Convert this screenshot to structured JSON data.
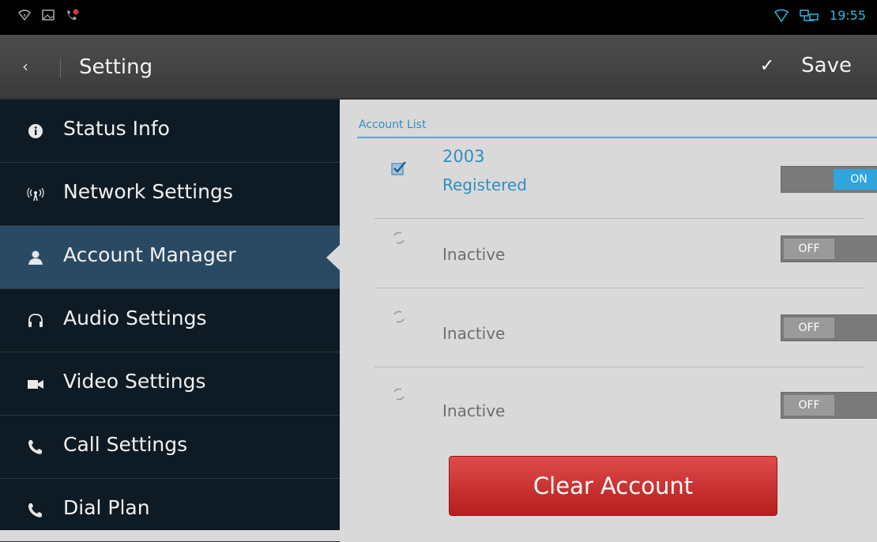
{
  "statusbar": {
    "time": "19:55"
  },
  "actionbar": {
    "back_glyph": "‹",
    "title": "Setting",
    "save_check": "✓",
    "save_label": "Save"
  },
  "sidebar": {
    "items": [
      {
        "label": "Status Info",
        "icon": "info-icon"
      },
      {
        "label": "Network Settings",
        "icon": "antenna-icon"
      },
      {
        "label": "Account Manager",
        "icon": "person-icon",
        "active": true
      },
      {
        "label": "Audio Settings",
        "icon": "headset-icon"
      },
      {
        "label": "Video Settings",
        "icon": "video-camera-icon"
      },
      {
        "label": "Call Settings",
        "icon": "phone-icon"
      },
      {
        "label": "Dial Plan",
        "icon": "phone-icon"
      }
    ]
  },
  "content": {
    "section_header": "Account List",
    "accounts": [
      {
        "name": "2003",
        "status": "Registered",
        "toggle": "ON",
        "icon": "check-icon"
      },
      {
        "name": "",
        "status": "Inactive",
        "toggle": "OFF",
        "icon": "refresh-icon"
      },
      {
        "name": "",
        "status": "Inactive",
        "toggle": "OFF",
        "icon": "refresh-icon"
      },
      {
        "name": "",
        "status": "Inactive",
        "toggle": "OFF",
        "icon": "refresh-icon"
      }
    ],
    "clear_button": "Clear Account"
  },
  "colors": {
    "accent": "#33b5e5",
    "sidebar_bg": "#0f1b24",
    "active_item": "#2a4a63",
    "danger": "#c62828"
  }
}
